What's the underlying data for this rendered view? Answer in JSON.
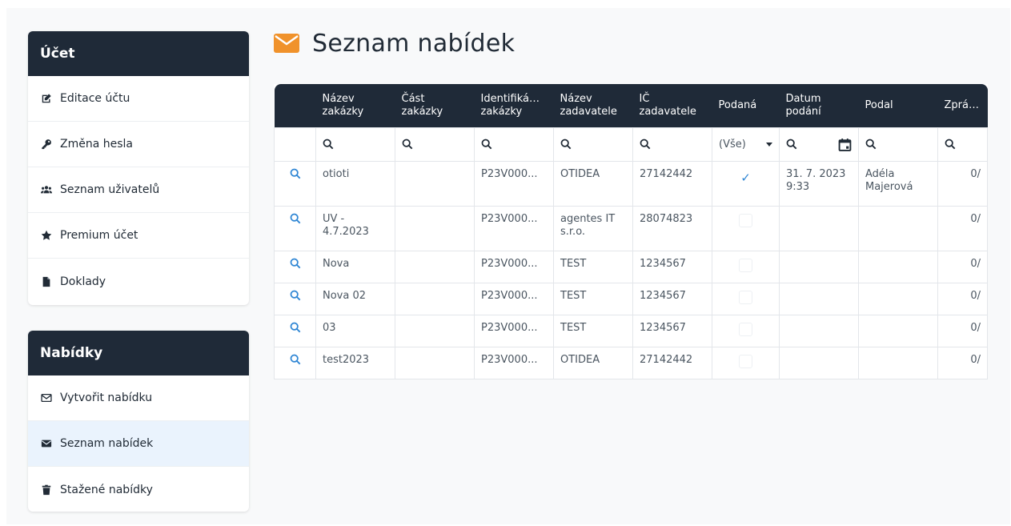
{
  "sidebar": {
    "account": {
      "title": "Účet",
      "items": [
        {
          "label": "Editace účtu",
          "icon": "edit-icon"
        },
        {
          "label": "Změna hesla",
          "icon": "key-icon"
        },
        {
          "label": "Seznam uživatelů",
          "icon": "users-icon"
        },
        {
          "label": "Premium účet",
          "icon": "star-icon"
        },
        {
          "label": "Doklady",
          "icon": "file-icon"
        }
      ]
    },
    "offers": {
      "title": "Nabídky",
      "items": [
        {
          "label": "Vytvořit nabídku",
          "icon": "envelope-outline-icon"
        },
        {
          "label": "Seznam nabídek",
          "icon": "envelope-icon"
        },
        {
          "label": "Stažené nabídky",
          "icon": "trash-icon"
        }
      ]
    }
  },
  "main": {
    "title": "Seznam nabídek",
    "accent_color": "#f0922b"
  },
  "table": {
    "columns": [
      "Název zakázky",
      "Část zakázky",
      "Identifiká… zakázky",
      "Název zadavatele",
      "IČ zadavatele",
      "Podaná",
      "Datum podání",
      "Podal",
      "Zprá…"
    ],
    "filter": {
      "podana_value": "(Vše)"
    },
    "rows": [
      {
        "nazev": "otioti",
        "cast": "",
        "ident": "P23V000...",
        "zadavatel": "OTIDEA",
        "ic": "27142442",
        "podana": true,
        "datum": "31. 7. 2023 9:33",
        "podal": "Adéla Majerová",
        "zpravy": "0/"
      },
      {
        "nazev": "UV - 4.7.2023",
        "cast": "",
        "ident": "P23V000...",
        "zadavatel": "agentes IT s.r.o.",
        "ic": "28074823",
        "podana": false,
        "datum": "",
        "podal": "",
        "zpravy": "0/"
      },
      {
        "nazev": "Nova",
        "cast": "",
        "ident": "P23V000...",
        "zadavatel": "TEST",
        "ic": "1234567",
        "podana": false,
        "datum": "",
        "podal": "",
        "zpravy": "0/"
      },
      {
        "nazev": "Nova 02",
        "cast": "",
        "ident": "P23V000...",
        "zadavatel": "TEST",
        "ic": "1234567",
        "podana": false,
        "datum": "",
        "podal": "",
        "zpravy": "0/"
      },
      {
        "nazev": "03",
        "cast": "",
        "ident": "P23V000...",
        "zadavatel": "TEST",
        "ic": "1234567",
        "podana": false,
        "datum": "",
        "podal": "",
        "zpravy": "0/"
      },
      {
        "nazev": "test2023",
        "cast": "",
        "ident": "P23V000...",
        "zadavatel": "OTIDEA",
        "ic": "27142442",
        "podana": false,
        "datum": "",
        "podal": "",
        "zpravy": "0/"
      }
    ]
  }
}
